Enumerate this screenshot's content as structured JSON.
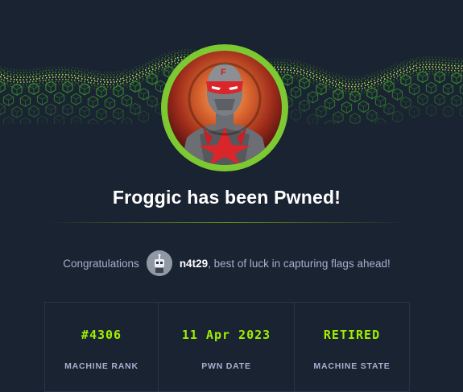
{
  "banner": {
    "icon": "digital-hexagon-wave"
  },
  "machine": {
    "avatar_icon": "masked-hero-avatar",
    "title": "Froggic has been Pwned!"
  },
  "congrats": {
    "lead": "Congratulations",
    "username": "n4t29",
    "tail": ", best of luck in capturing flags ahead!",
    "avatar_icon": "robot-avatar-icon"
  },
  "stats": [
    {
      "value": "#4306",
      "label": "MACHINE RANK"
    },
    {
      "value": "11 Apr 2023",
      "label": "PWN DATE"
    },
    {
      "value": "RETIRED",
      "label": "MACHINE STATE"
    }
  ],
  "colors": {
    "background": "#1a2332",
    "accent": "#9fef00",
    "muted_text": "#a4b1cd",
    "border": "#283447"
  }
}
